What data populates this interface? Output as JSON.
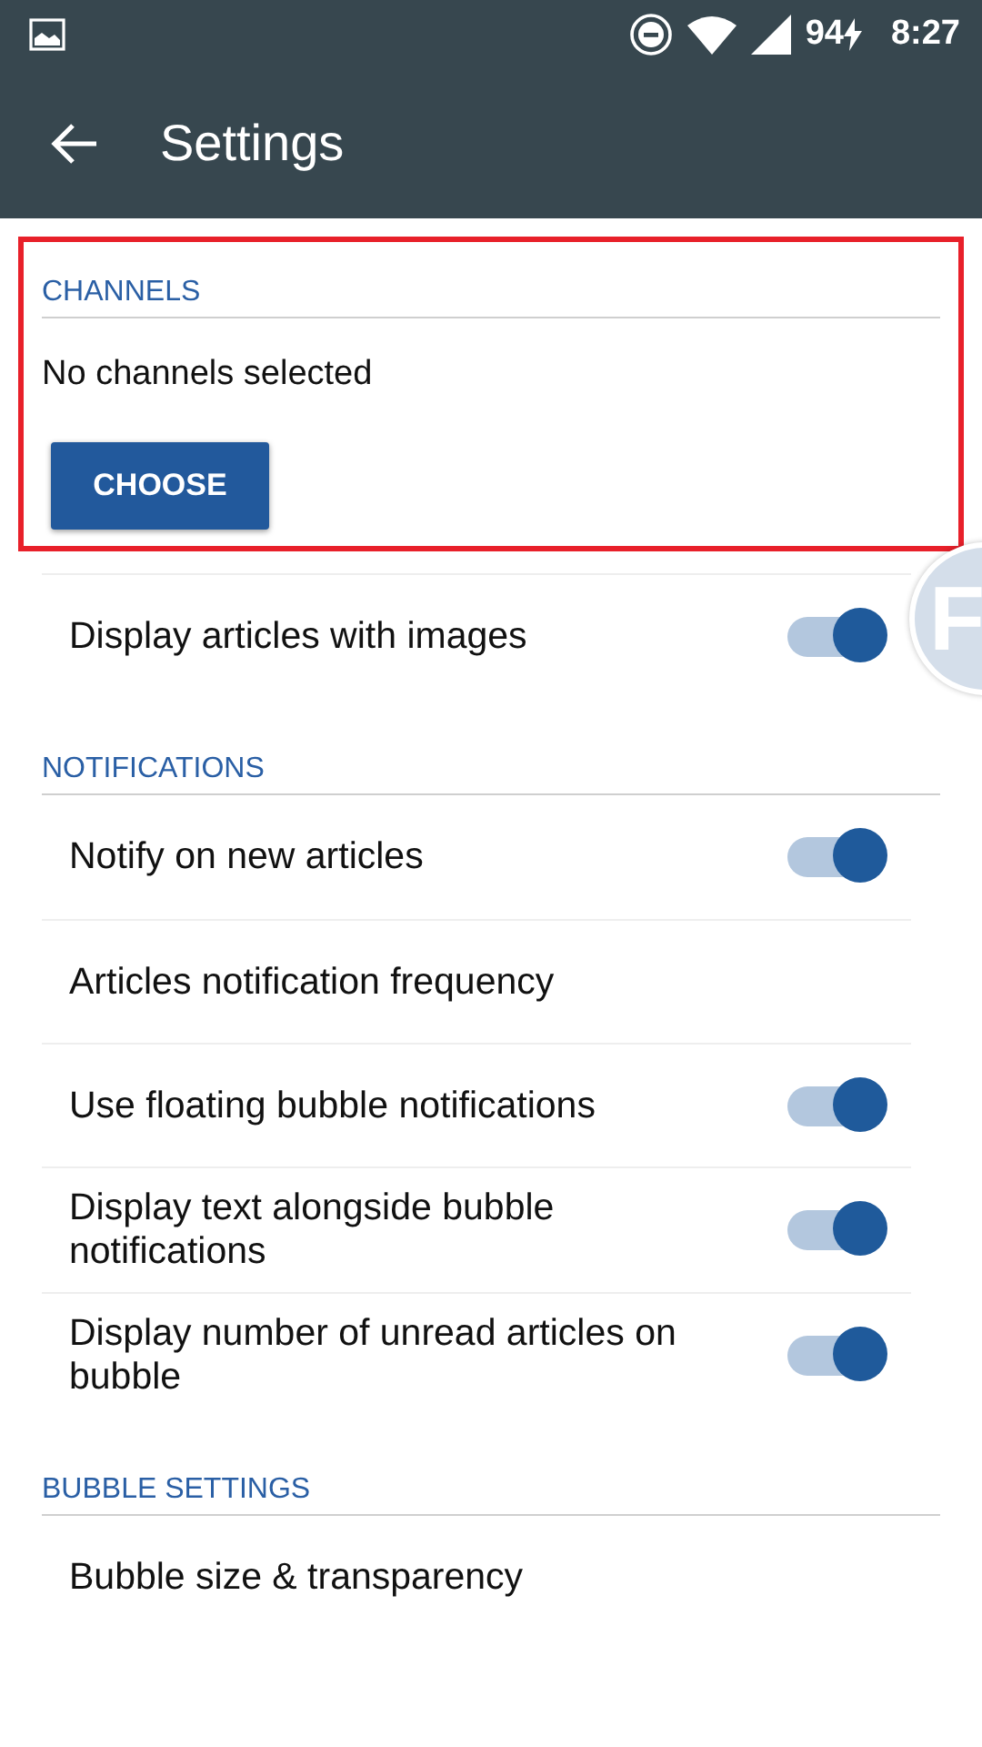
{
  "status_bar": {
    "battery": "94",
    "time": "8:27"
  },
  "toolbar": {
    "title": "Settings"
  },
  "channels": {
    "header": "CHANNELS",
    "text": "No channels selected",
    "button": "CHOOSE",
    "highlighted": true
  },
  "sections": [
    {
      "items": [
        {
          "kind": "toggle",
          "label": "Display articles with images",
          "on": true
        }
      ]
    },
    {
      "header": "NOTIFICATIONS",
      "items": [
        {
          "kind": "toggle",
          "label": "Notify on new articles",
          "on": true
        },
        {
          "kind": "plain",
          "label": "Articles notification frequency"
        },
        {
          "kind": "toggle",
          "label": "Use floating bubble notifications",
          "on": true
        },
        {
          "kind": "toggle",
          "label": "Display text alongside bubble notifications",
          "on": true
        },
        {
          "kind": "toggle",
          "label": "Display number of unread articles on bubble",
          "on": true
        }
      ]
    },
    {
      "header": "BUBBLE SETTINGS",
      "items": [
        {
          "kind": "plain",
          "label": "Bubble size & transparency"
        }
      ]
    }
  ],
  "bubble": {
    "letter": "F"
  }
}
